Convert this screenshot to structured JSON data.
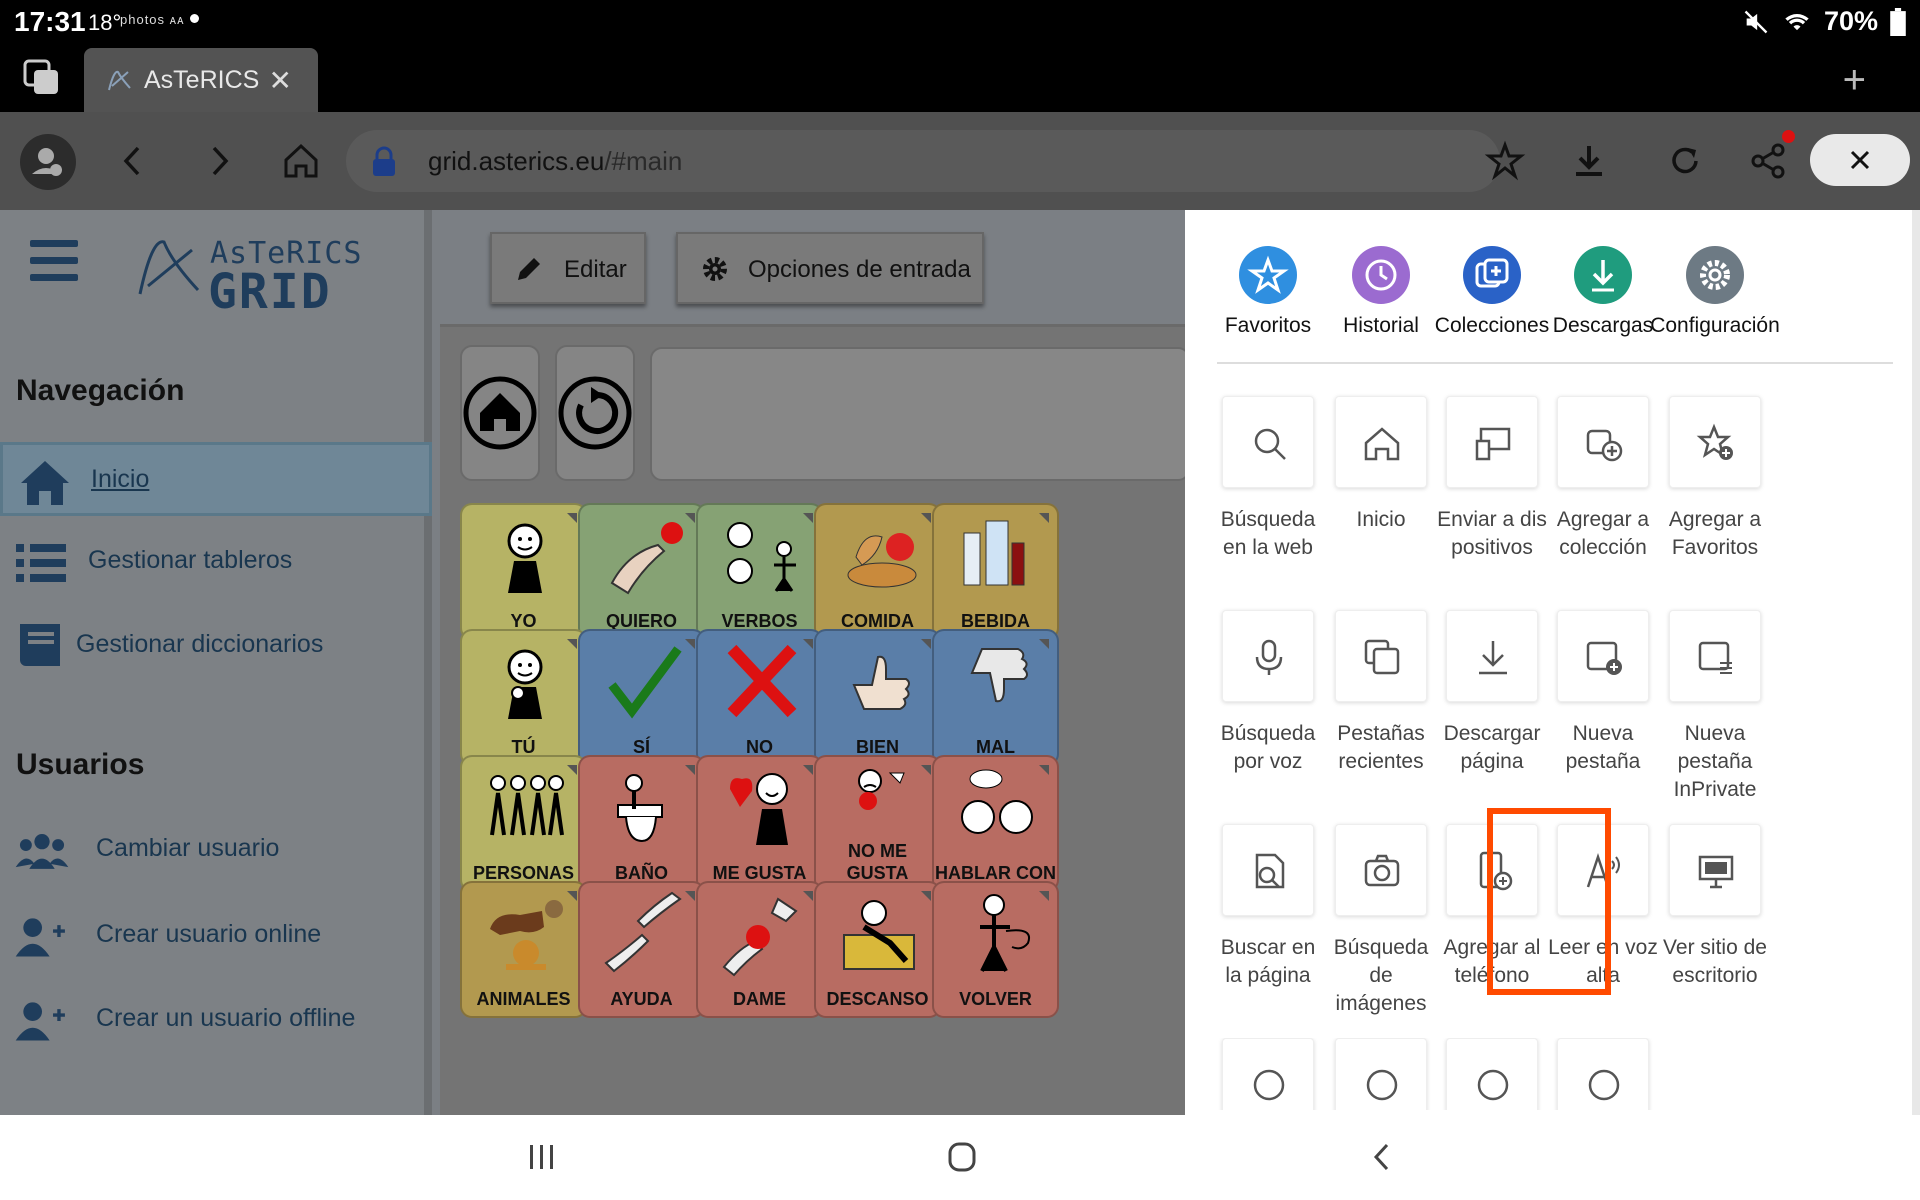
{
  "status": {
    "time": "17:31",
    "temp": "18°",
    "noti": "photos ᴀᴀ",
    "battery": "70%"
  },
  "tab": {
    "title": "AsTeRICS",
    "close": "✕",
    "new": "+"
  },
  "address": {
    "host": "grid.asterics.eu",
    "path": "/#main"
  },
  "logo": {
    "line1": "AsTeRICS",
    "line2": "GRID"
  },
  "sidebar": {
    "nav_title": "Navegación",
    "nav_items": [
      {
        "label": "Inicio",
        "icon": "home-icon"
      },
      {
        "label": "Gestionar tableros",
        "icon": "list-icon"
      },
      {
        "label": "Gestionar diccionarios",
        "icon": "book-icon"
      }
    ],
    "users_title": "Usuarios",
    "user_items": [
      {
        "label": "Cambiar usuario",
        "icon": "users-icon"
      },
      {
        "label": "Crear usuario online",
        "icon": "user-plus-icon"
      },
      {
        "label": "Crear un usuario offline",
        "icon": "user-plus-icon"
      }
    ]
  },
  "toolbar": {
    "edit": "Editar",
    "input_options": "Opciones de entrada"
  },
  "grid": [
    {
      "label": "YO",
      "color": "#b6b365"
    },
    {
      "label": "QUIERO",
      "color": "#86a274"
    },
    {
      "label": "VERBOS",
      "color": "#86a274"
    },
    {
      "label": "COMIDA",
      "color": "#b2994f"
    },
    {
      "label": "BEBIDA",
      "color": "#b2994f"
    },
    {
      "label": "TÚ",
      "color": "#b6b365"
    },
    {
      "label": "SÍ",
      "color": "#5a7ea8"
    },
    {
      "label": "NO",
      "color": "#5a7ea8"
    },
    {
      "label": "BIEN",
      "color": "#5a7ea8"
    },
    {
      "label": "MAL",
      "color": "#5a7ea8"
    },
    {
      "label": "PERSONAS",
      "color": "#b6b365"
    },
    {
      "label": "BAÑO",
      "color": "#b86c62"
    },
    {
      "label": "ME GUSTA",
      "color": "#b86c62"
    },
    {
      "label": "NO ME GUSTA",
      "color": "#b86c62"
    },
    {
      "label": "HABLAR CON",
      "color": "#b86c62"
    },
    {
      "label": "ANIMALES",
      "color": "#b2994f"
    },
    {
      "label": "AYUDA",
      "color": "#b86c62"
    },
    {
      "label": "DAME",
      "color": "#b86c62"
    },
    {
      "label": "DESCANSO",
      "color": "#b86c62"
    },
    {
      "label": "VOLVER",
      "color": "#b86c62"
    }
  ],
  "menu": {
    "quick": [
      {
        "label": "Favoritos",
        "color": "#2f8fe0",
        "icon": "star-icon"
      },
      {
        "label": "Historial",
        "color": "#9b6bd0",
        "icon": "history-icon"
      },
      {
        "label": "Colecciones",
        "color": "#2a62c7",
        "icon": "collections-icon"
      },
      {
        "label": "Descargas",
        "color": "#1f9c7e",
        "icon": "download-icon"
      },
      {
        "label": "Configuración",
        "color": "#6d7a84",
        "icon": "gear-icon"
      }
    ],
    "items": [
      {
        "label": "Búsqueda\nen la web",
        "icon": "search-icon"
      },
      {
        "label": "Inicio",
        "icon": "home-icon"
      },
      {
        "label": "Enviar a dis\npositivos",
        "icon": "send-devices-icon"
      },
      {
        "label": "Agregar a\ncolección",
        "icon": "add-collection-icon"
      },
      {
        "label": "Agregar a\nFavoritos",
        "icon": "add-favorite-icon"
      },
      {
        "label": "Búsqueda\npor voz",
        "icon": "mic-icon"
      },
      {
        "label": "Pestañas\nrecientes",
        "icon": "recent-tabs-icon"
      },
      {
        "label": "Descargar\npágina",
        "icon": "download-page-icon"
      },
      {
        "label": "Nueva\npestaña",
        "icon": "new-tab-icon"
      },
      {
        "label": "Nueva\npestaña\nInPrivate",
        "icon": "inprivate-icon"
      },
      {
        "label": "Buscar en\nla página",
        "icon": "find-page-icon"
      },
      {
        "label": "Búsqueda\nde\nimágenes",
        "icon": "camera-icon"
      },
      {
        "label": "Agregar al\nteléfono",
        "icon": "add-phone-icon"
      },
      {
        "label": "Leer en voz\nalta",
        "icon": "read-aloud-icon"
      },
      {
        "label": "Ver sitio de\nescritorio",
        "icon": "desktop-icon"
      }
    ]
  }
}
